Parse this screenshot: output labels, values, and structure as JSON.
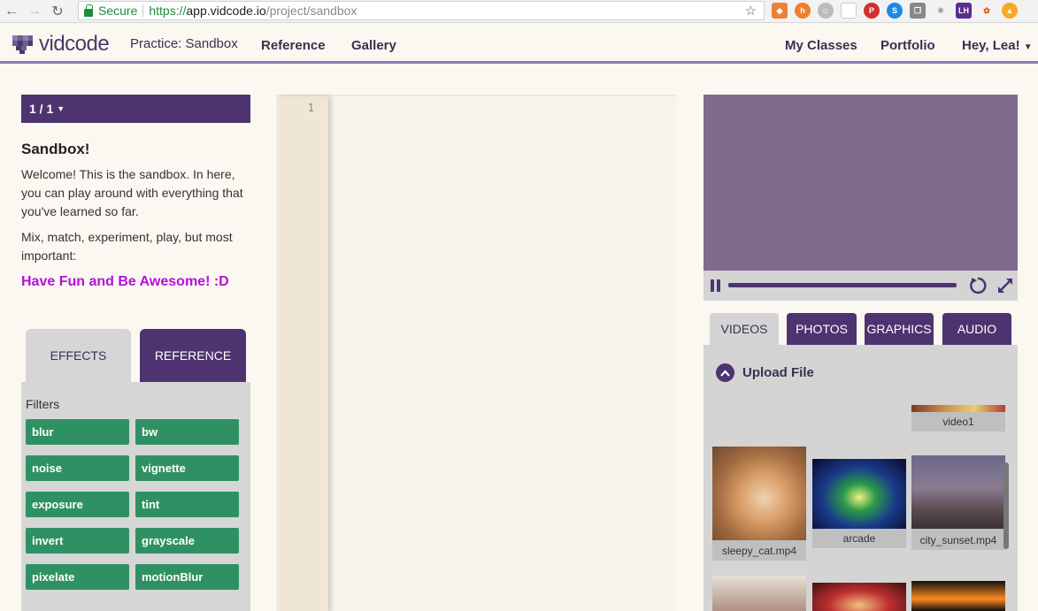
{
  "browser": {
    "secure_label": "Secure",
    "url_scheme": "https://",
    "url_domain": "app.vidcode.io",
    "url_path": "/project/sandbox",
    "extension_label": "LH"
  },
  "header": {
    "logo_text": "vidcode",
    "nav": {
      "practice": "Practice: Sandbox",
      "reference": "Reference",
      "gallery": "Gallery",
      "my_classes": "My Classes",
      "portfolio": "Portfolio",
      "greeting": "Hey, Lea!"
    }
  },
  "lesson": {
    "level": "1 / 1",
    "title": "Sandbox!",
    "paragraph1": "Welcome! This is the sandbox. In here, you can play around with everything that you've learned so far.",
    "paragraph2": "Mix, match, experiment, play, but most important:",
    "highlight": "Have Fun and Be Awesome! :D"
  },
  "left_tabs": {
    "effects": "EFFECTS",
    "reference": "REFERENCE"
  },
  "filters": {
    "label": "Filters",
    "buttons": [
      "blur",
      "bw",
      "noise",
      "vignette",
      "exposure",
      "tint",
      "invert",
      "grayscale",
      "pixelate",
      "motionBlur"
    ]
  },
  "editor": {
    "line_number": "1"
  },
  "media_tabs": {
    "videos": "VIDEOS",
    "photos": "PHOTOS",
    "graphics": "GRAPHICS",
    "audio": "AUDIO"
  },
  "media": {
    "upload_label": "Upload File",
    "items": [
      "video1",
      "sleepy_cat.mp4",
      "arcade",
      "city_sunset.mp4"
    ]
  },
  "colors": {
    "brand_purple": "#4d3470",
    "filter_green": "#2f9163",
    "highlight_magenta": "#b411d8",
    "preview_bg": "#806a8b"
  }
}
